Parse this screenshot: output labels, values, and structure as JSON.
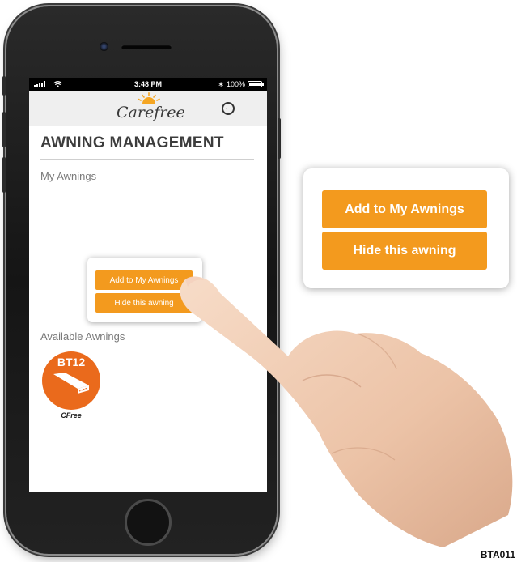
{
  "status_bar": {
    "time": "3:48 PM",
    "battery": "100%",
    "battery_level": 1.0
  },
  "header": {
    "logo_text": "Carefree",
    "back_icon": "back-circle-arrow-icon"
  },
  "page": {
    "title": "AWNING MANAGEMENT"
  },
  "my_awnings": {
    "label": "My Awnings"
  },
  "popup": {
    "add_label": "Add to My Awnings",
    "hide_label": "Hide this awning"
  },
  "available_awnings": {
    "label": "Available Awnings",
    "items": [
      {
        "code": "BT12",
        "name": "CFree",
        "icon": "awning-icon"
      }
    ]
  },
  "callout": {
    "add_label": "Add to My Awnings",
    "hide_label": "Hide this awning"
  },
  "figure_code": "BTA011",
  "colors": {
    "accent": "#f39a1e",
    "badge": "#ea6a1c",
    "header_bg": "#efefef"
  }
}
